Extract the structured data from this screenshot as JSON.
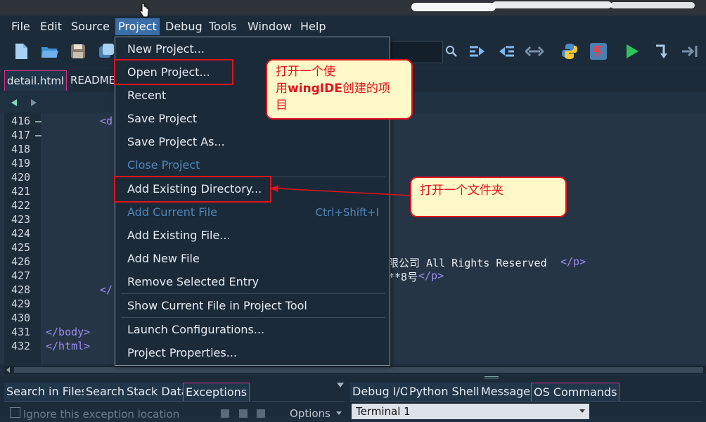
{
  "menubar": {
    "items": [
      {
        "label": "File",
        "active": false
      },
      {
        "label": "Edit",
        "active": false
      },
      {
        "label": "Source",
        "active": false
      },
      {
        "label": "Project",
        "active": true
      },
      {
        "label": "Debug",
        "active": false
      },
      {
        "label": "Tools",
        "active": false
      },
      {
        "label": "Window",
        "active": false
      },
      {
        "label": "Help",
        "active": false
      }
    ]
  },
  "file_tabs": [
    {
      "label": "detail.html",
      "active": true
    },
    {
      "label": "README",
      "active": false
    }
  ],
  "editor": {
    "line_numbers": [
      "416",
      "417",
      "418",
      "419",
      "420",
      "421",
      "422",
      "423",
      "424",
      "425",
      "426",
      "427",
      "428",
      "429",
      "430",
      "431",
      "432"
    ],
    "code_line_416_tag": "<d",
    "code_line_426_text": "限公司 All Rights Reserved",
    "code_line_426_close": "</p>",
    "code_line_427_text": "**8号",
    "code_line_427_close": "</p>",
    "code_line_428_tag": "</",
    "code_line_431": "</body>",
    "code_line_432": "</html>"
  },
  "project_menu": {
    "items": [
      {
        "label": "New Project...",
        "enabled": true
      },
      {
        "label": "Open Project...",
        "enabled": true
      },
      {
        "label": "Recent",
        "enabled": true
      },
      {
        "label": "Save Project",
        "enabled": true
      },
      {
        "label": "Save Project As...",
        "enabled": true
      },
      {
        "label": "Close Project",
        "enabled": false
      },
      {
        "label": "Add Existing Directory...",
        "enabled": true
      },
      {
        "label": "Add Current File",
        "enabled": false,
        "shortcut": "Ctrl+Shift+I"
      },
      {
        "label": "Add Existing File...",
        "enabled": true
      },
      {
        "label": "Add New File",
        "enabled": true
      },
      {
        "label": "Remove Selected Entry",
        "enabled": true
      },
      {
        "label": "Show Current File in Project Tool",
        "enabled": true
      },
      {
        "label": "Launch Configurations...",
        "enabled": true
      },
      {
        "label": "Project Properties...",
        "enabled": true
      }
    ]
  },
  "annotations": {
    "open_project_note_line1": "打开一个使",
    "open_project_note_line2_prefix": "用",
    "open_project_note_line2_bold": "wingIDE",
    "open_project_note_line2_suffix": "创建的项",
    "open_project_note_line3": "目",
    "add_dir_note": "打开一个文件夹",
    "highlight_color": "#e0141c",
    "callout_bg": "#fff8c8"
  },
  "bottom_left_tabs": [
    "Search in Files",
    "Search",
    "Stack Data",
    "Exceptions"
  ],
  "bottom_left_active": "Exceptions",
  "exceptions_panel": {
    "ignore_label": "Ignore this exception location",
    "options_label": "Options"
  },
  "bottom_right_tabs": [
    "Debug I/O",
    "Python Shell",
    "Messages",
    "OS Commands"
  ],
  "bottom_right_active": "OS Commands",
  "os_commands": {
    "selected": "Terminal 1"
  },
  "icons": [
    "new-file-icon",
    "open-folder-icon",
    "save-icon",
    "save-all-icon",
    "search-icon",
    "step-into-icon",
    "step-out-icon",
    "step-over-icon",
    "python-icon",
    "debug-config-icon",
    "run-icon",
    "step-cursor-icon",
    "run-to-end-icon"
  ]
}
